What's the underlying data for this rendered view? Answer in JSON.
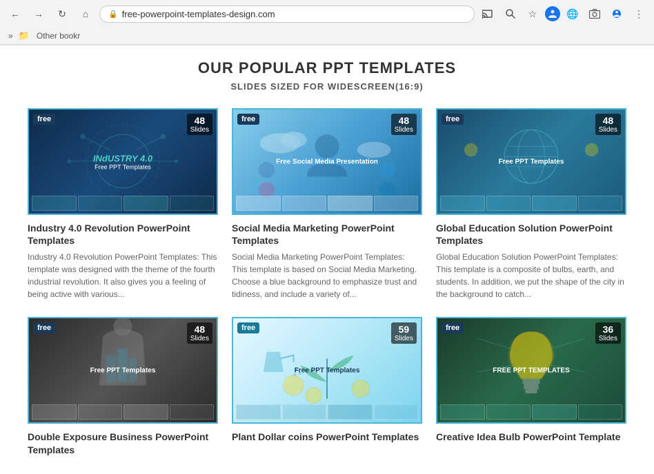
{
  "browser": {
    "url": "free-powerpoint-templates-design.com",
    "back_btn": "←",
    "forward_btn": "→",
    "reload_btn": "↺",
    "home_btn": "⌂",
    "cast_icon": "📺",
    "search_icon": "🔍",
    "star_icon": "☆",
    "update_icon": "🔵",
    "globe_icon": "🌐",
    "photo_icon": "🖼",
    "profile_icon": "👤",
    "more_icon": "⋮",
    "bookmarks_chevron": "»",
    "other_bookmarks": "Other bookr"
  },
  "page": {
    "heading": "OUR POPULAR PPT TEMPLATES",
    "subheading": "SLIDES SIZED FOR WIDESCREEN(16:9)"
  },
  "templates": [
    {
      "id": "industry-40",
      "name": "Industry 4.0 Revolution PowerPoint Templates",
      "description": "Industry 4.0 Revolution PowerPoint Templates: This template was designed with the theme of the fourth industrial revolution. It also gives you a feeling of being active with various...",
      "free_label": "free",
      "slides_count": "48",
      "slides_label": "Slides",
      "bg_type": "dark-blue",
      "card_title": "INdUSTRY 4.0",
      "card_subtitle": "Free PPT Templates"
    },
    {
      "id": "social-media",
      "name": "Social Media Marketing PowerPoint Templates",
      "description": "Social Media Marketing PowerPoint Templates: This template is based on Social Media Marketing. Choose a blue background to emphasize trust and tidiness, and include a variety of...",
      "free_label": "free",
      "slides_count": "48",
      "slides_label": "Slides",
      "bg_type": "light-blue",
      "card_title": "Free Social Media Presentation",
      "card_subtitle": ""
    },
    {
      "id": "global-education",
      "name": "Global Education Solution PowerPoint Templates",
      "description": "Global Education Solution PowerPoint Templates: This template is a composite of bulbs, earth, and students. In addition, we put the shape of the city in the background to catch...",
      "free_label": "free",
      "slides_count": "48",
      "slides_label": "Slides",
      "bg_type": "teal-blue",
      "card_title": "Free PPT Templates",
      "card_subtitle": ""
    },
    {
      "id": "double-exposure",
      "name": "Double Exposure Business PowerPoint Templates",
      "description": "",
      "free_label": "free",
      "slides_count": "48",
      "slides_label": "Slides",
      "bg_type": "dark-gray",
      "card_title": "Free PPT Templates",
      "card_subtitle": ""
    },
    {
      "id": "plant-dollar",
      "name": "Plant Dollar coins PowerPoint Templates",
      "description": "",
      "free_label": "free",
      "slides_count": "59",
      "slides_label": "Slides",
      "bg_type": "light-cyan",
      "card_title": "Free PPT Templates",
      "card_subtitle": ""
    },
    {
      "id": "creative-idea",
      "name": "Creative Idea Bulb PowerPoint Template",
      "description": "",
      "free_label": "free",
      "slides_count": "36",
      "slides_label": "Slides",
      "bg_type": "dark-green",
      "card_title": "FREE PPT TEMPLATES",
      "card_subtitle": ""
    }
  ]
}
